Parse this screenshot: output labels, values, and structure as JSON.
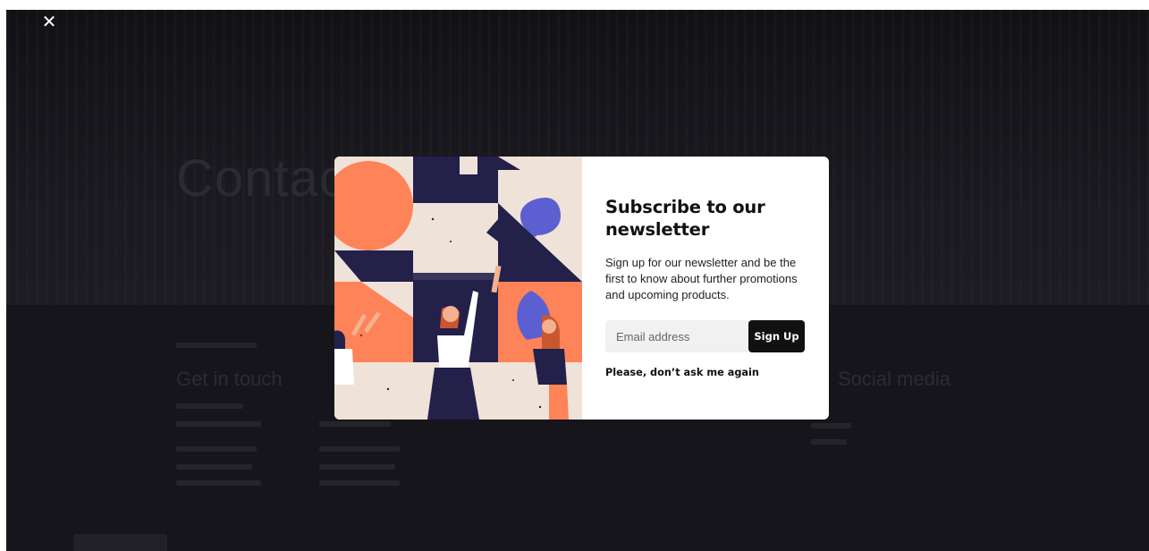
{
  "background_page": {
    "hero_title": "Contact",
    "section_left_title": "Get in touch",
    "section_right_title": "Social media"
  },
  "close_icon": "close-icon",
  "modal": {
    "title": "Subscribe to our newsletter",
    "description": "Sign up for our newsletter and be the first to know about further promotions and upcoming products.",
    "email_placeholder": "Email address",
    "signup_label": "Sign Up",
    "dismiss_label": "Please, don’t ask me again"
  },
  "colors": {
    "overlay_bg": "#16151c",
    "navy": "#23204a",
    "orange": "#ff8358",
    "cream": "#efe2d8",
    "purple": "#5c5fcf",
    "button_bg": "#111111"
  }
}
